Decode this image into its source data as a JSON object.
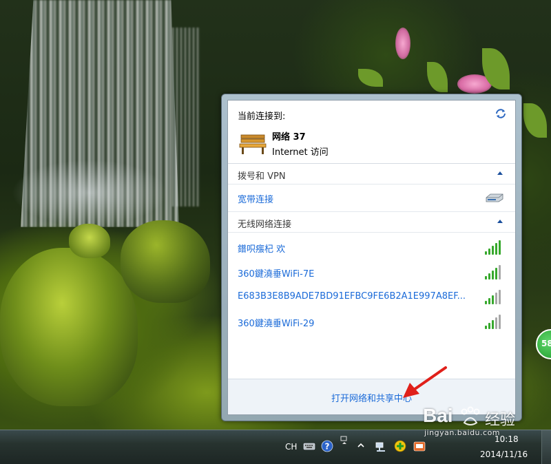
{
  "popup": {
    "connected_title": "当前连接到:",
    "network_name": "网络  37",
    "network_access": "Internet 访问",
    "dial_section": {
      "title": "拨号和 VPN",
      "items": [
        {
          "label": "宽带连接",
          "icon": "modem-icon"
        }
      ]
    },
    "wireless_section": {
      "title": "无线网络连接",
      "items": [
        {
          "label": "鐠呮瘬杞   欢",
          "signal": 5
        },
        {
          "label": "360鍵澆垂WiFi-7E",
          "signal": 4
        },
        {
          "label": "E683B3E8B9ADE7BD91EFBC9FE6B2A1E997A8EF...",
          "signal": 3
        },
        {
          "label": "360鍵澆垂WiFi-29",
          "signal": 3
        }
      ]
    },
    "footer_link": "打开网络和共享中心"
  },
  "taskbar": {
    "language": "CH",
    "clock_time": "10:18",
    "clock_date": "2014/11/16"
  },
  "edge_badge": "58",
  "watermark": {
    "brand": "Bai",
    "sub": "经验",
    "url": "jingyan.baidu.com"
  },
  "colors": {
    "link_blue": "#1a6ad8",
    "signal_on": "#36a82c",
    "signal_off": "#a8a8a8",
    "arrow_red": "#e0201a"
  }
}
